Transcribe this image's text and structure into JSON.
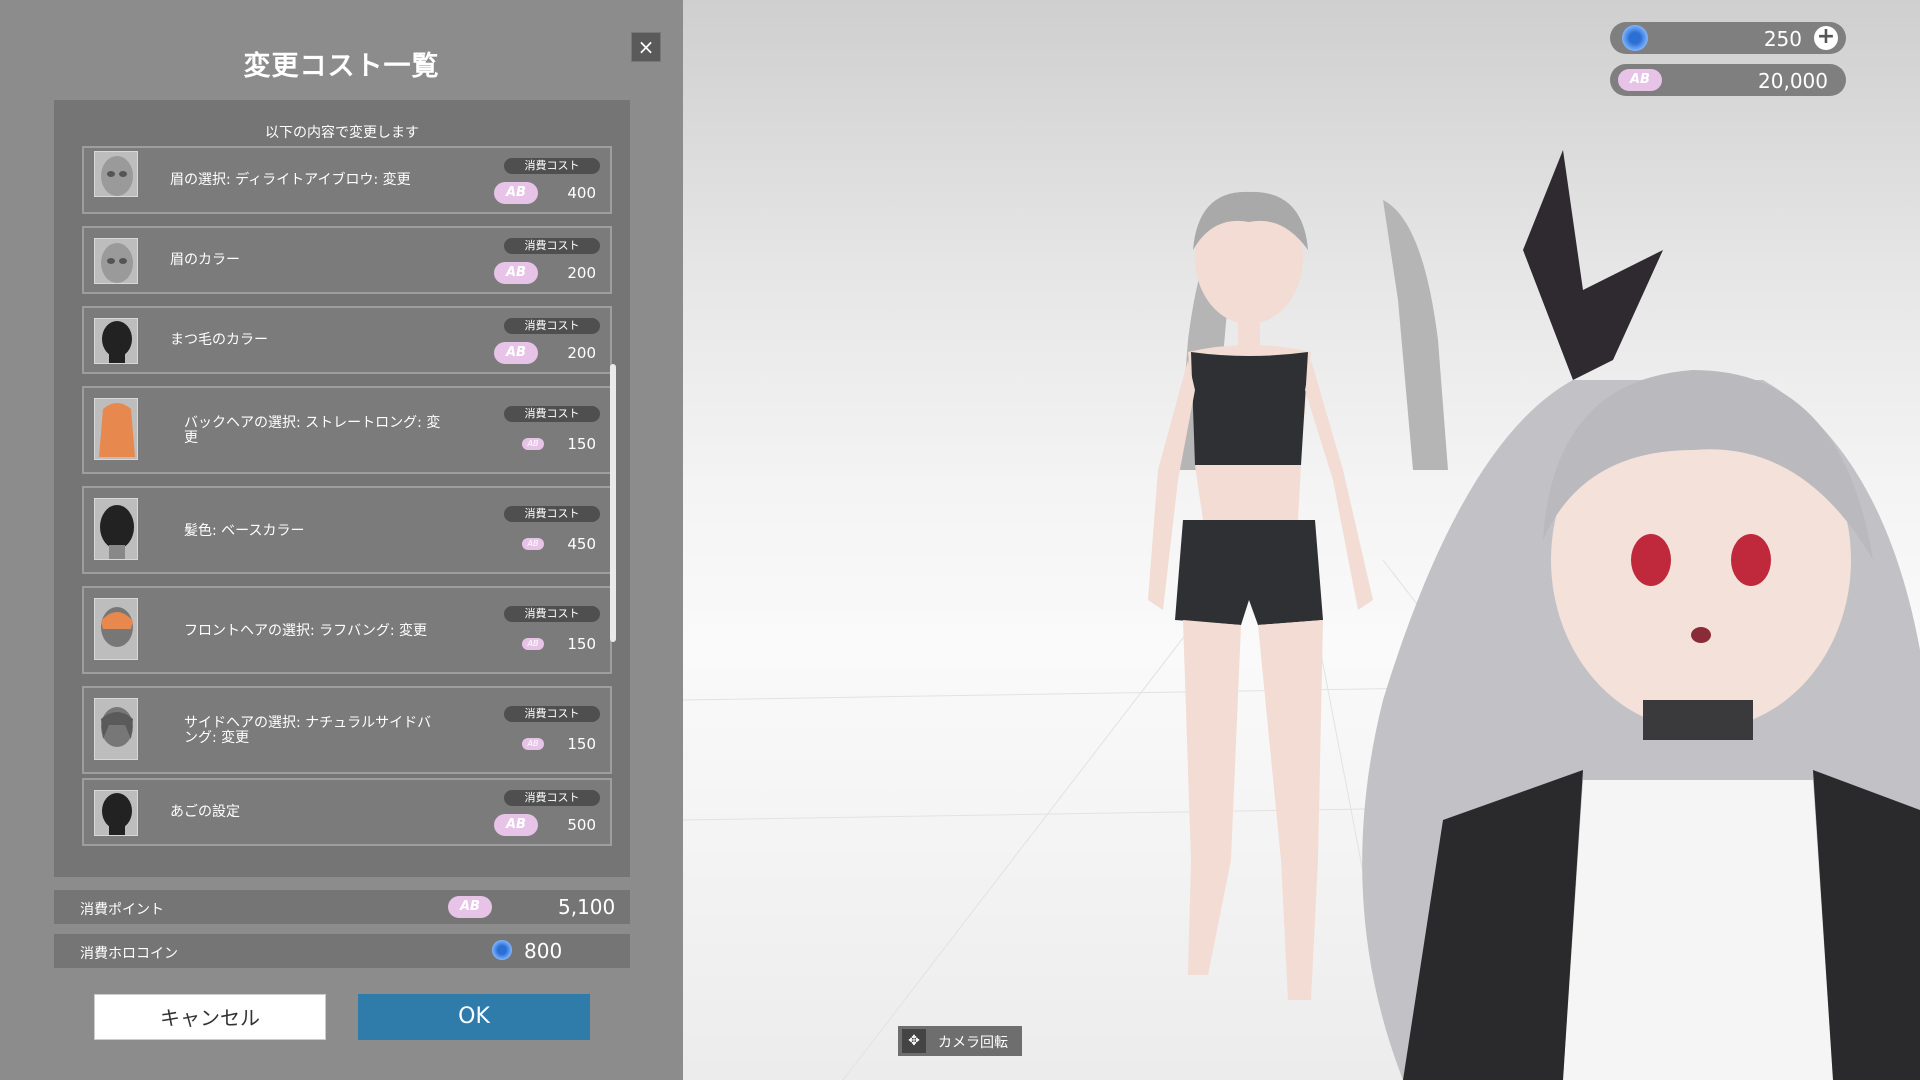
{
  "dialog": {
    "title": "変更コスト一覧",
    "close_label": "×",
    "subtitle": "以下の内容で変更します",
    "cost_tag": "消費コスト",
    "coin_mark": "AB",
    "items": [
      {
        "label": "眉の選択: ディライトアイブロウ: 変更",
        "cost": "400"
      },
      {
        "label": "眉のカラー",
        "cost": "200"
      },
      {
        "label": "まつ毛のカラー",
        "cost": "200"
      },
      {
        "label": "バックヘアの選択: ストレートロング: 変更",
        "cost": "150"
      },
      {
        "label": "髪色: ベースカラー",
        "cost": "450"
      },
      {
        "label": "フロントヘアの選択: ラフバング: 変更",
        "cost": "150"
      },
      {
        "label": "サイドヘアの選択: ナチュラルサイドバング: 変更",
        "cost": "150"
      },
      {
        "label": "あごの設定",
        "cost": "500"
      }
    ],
    "summary": {
      "points_label": "消費ポイント",
      "points_value": "5,100",
      "coins_label": "消費ホロコイン",
      "coins_value": "800"
    },
    "cancel_label": "キャンセル",
    "ok_label": "OK"
  },
  "currency": {
    "holo_coins": "250",
    "points": "20,000",
    "add_label": "+"
  },
  "camera": {
    "label": "カメラ回転"
  },
  "colors": {
    "panel": "#8c8c8c",
    "ok_button": "#2f7cab",
    "coin": "#e7c3e8"
  }
}
